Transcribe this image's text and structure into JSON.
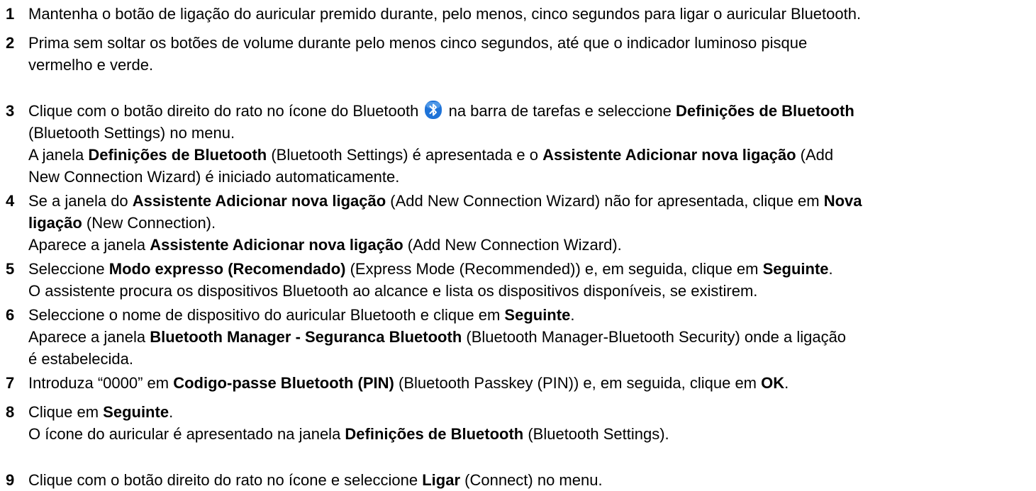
{
  "steps": [
    {
      "number": "1",
      "lines": [
        [
          "Mantenha o botão de ligação do auricular premido durante, pelo menos, cinco segundos para ligar o auricular Bluetooth."
        ]
      ]
    },
    {
      "number": "2",
      "lines": [
        [
          "Prima sem soltar os botões de volume durante pelo menos cinco segundos, até que o indicador luminoso pisque"
        ],
        [
          "vermelho e verde."
        ]
      ]
    },
    {
      "number": "3",
      "lines": [
        [
          "Clique com o botão direito do rato no ícone do Bluetooth ",
          " na barra de tarefas e seleccione ",
          "Definições de Bluetooth"
        ],
        [
          "(Bluetooth Settings) no menu."
        ],
        [
          "A janela ",
          "Definições de Bluetooth",
          " (Bluetooth Settings) é apresentada e o ",
          "Assistente Adicionar nova ligação",
          " (Add"
        ],
        [
          "New Connection Wizard) é iniciado automaticamente."
        ]
      ]
    },
    {
      "number": "4",
      "lines": [
        [
          "Se a janela do ",
          "Assistente Adicionar nova ligação",
          " (Add New Connection Wizard) não for apresentada, clique em ",
          "Nova"
        ],
        [
          "ligação",
          " (New Connection)."
        ],
        [
          "Aparece a janela ",
          "Assistente Adicionar nova ligação",
          " (Add New Connection Wizard)."
        ]
      ]
    },
    {
      "number": "5",
      "lines": [
        [
          "Seleccione ",
          "Modo expresso (Recomendado)",
          " (Express Mode (Recommended)) e, em seguida, clique em ",
          "Seguinte",
          "."
        ],
        [
          "O assistente procura os dispositivos Bluetooth ao alcance e lista os dispositivos disponíveis, se existirem."
        ]
      ]
    },
    {
      "number": "6",
      "lines": [
        [
          "Seleccione o nome de dispositivo do auricular Bluetooth e clique em ",
          "Seguinte",
          "."
        ],
        [
          "Aparece a janela ",
          "Bluetooth Manager - Seguranca Bluetooth",
          " (Bluetooth Manager-Bluetooth Security) onde a ligação"
        ],
        [
          "é estabelecida."
        ]
      ]
    },
    {
      "number": "7",
      "lines": [
        [
          "Introduza “0000” em ",
          "Codigo-passe Bluetooth (PIN)",
          " (Bluetooth Passkey (PIN)) e, em seguida, clique em ",
          "OK",
          "."
        ]
      ]
    },
    {
      "number": "8",
      "lines": [
        [
          "Clique em ",
          "Seguinte",
          "."
        ],
        [
          "O ícone do auricular é apresentado na janela ",
          "Definições de Bluetooth",
          " (Bluetooth Settings)."
        ]
      ]
    },
    {
      "number": "9",
      "lines": [
        [
          "Clique com o botão direito do rato no ícone e seleccione ",
          "Ligar",
          " (Connect) no menu."
        ]
      ]
    }
  ],
  "icons": {
    "bluetooth_icon": "bluetooth-icon",
    "bluetooth_color": "#1e73d8"
  }
}
